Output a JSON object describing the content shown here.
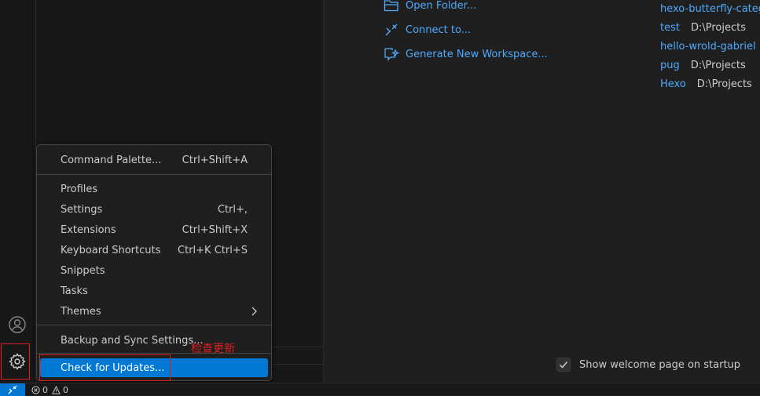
{
  "start": {
    "items": [
      {
        "label": "Open Folder...",
        "icon": "open-folder-icon"
      },
      {
        "label": "Connect to...",
        "icon": "remote-connect-icon"
      },
      {
        "label": "Generate New Workspace...",
        "icon": "sparkle-workspace-icon"
      }
    ]
  },
  "recent": {
    "items": [
      {
        "name": "hexo-butterfly-catego",
        "path": ""
      },
      {
        "name": "test",
        "path": "D:\\Projects"
      },
      {
        "name": "hello-wrold-gabriel",
        "path": ""
      },
      {
        "name": "pug",
        "path": "D:\\Projects"
      },
      {
        "name": "Hexo",
        "path": "D:\\Projects"
      }
    ]
  },
  "menu": {
    "command_palette": {
      "label": "Command Palette...",
      "shortcut": "Ctrl+Shift+A"
    },
    "profiles": {
      "label": "Profiles"
    },
    "settings": {
      "label": "Settings",
      "shortcut": "Ctrl+,"
    },
    "extensions": {
      "label": "Extensions",
      "shortcut": "Ctrl+Shift+X"
    },
    "keyboard_shortcuts": {
      "label": "Keyboard Shortcuts",
      "shortcut": "Ctrl+K Ctrl+S"
    },
    "snippets": {
      "label": "Snippets"
    },
    "tasks": {
      "label": "Tasks"
    },
    "themes": {
      "label": "Themes"
    },
    "backup_sync": {
      "label": "Backup and Sync Settings..."
    },
    "check_updates": {
      "label": "Check for Updates..."
    }
  },
  "annotation": {
    "text": "检查更新"
  },
  "welcome": {
    "show_on_startup": "Show welcome page on startup",
    "checked": true
  },
  "statusbar": {
    "errors": "0",
    "warnings": "0"
  },
  "colors": {
    "accent": "#0078d4",
    "link": "#4daafc",
    "annotation_red": "#e02020"
  }
}
